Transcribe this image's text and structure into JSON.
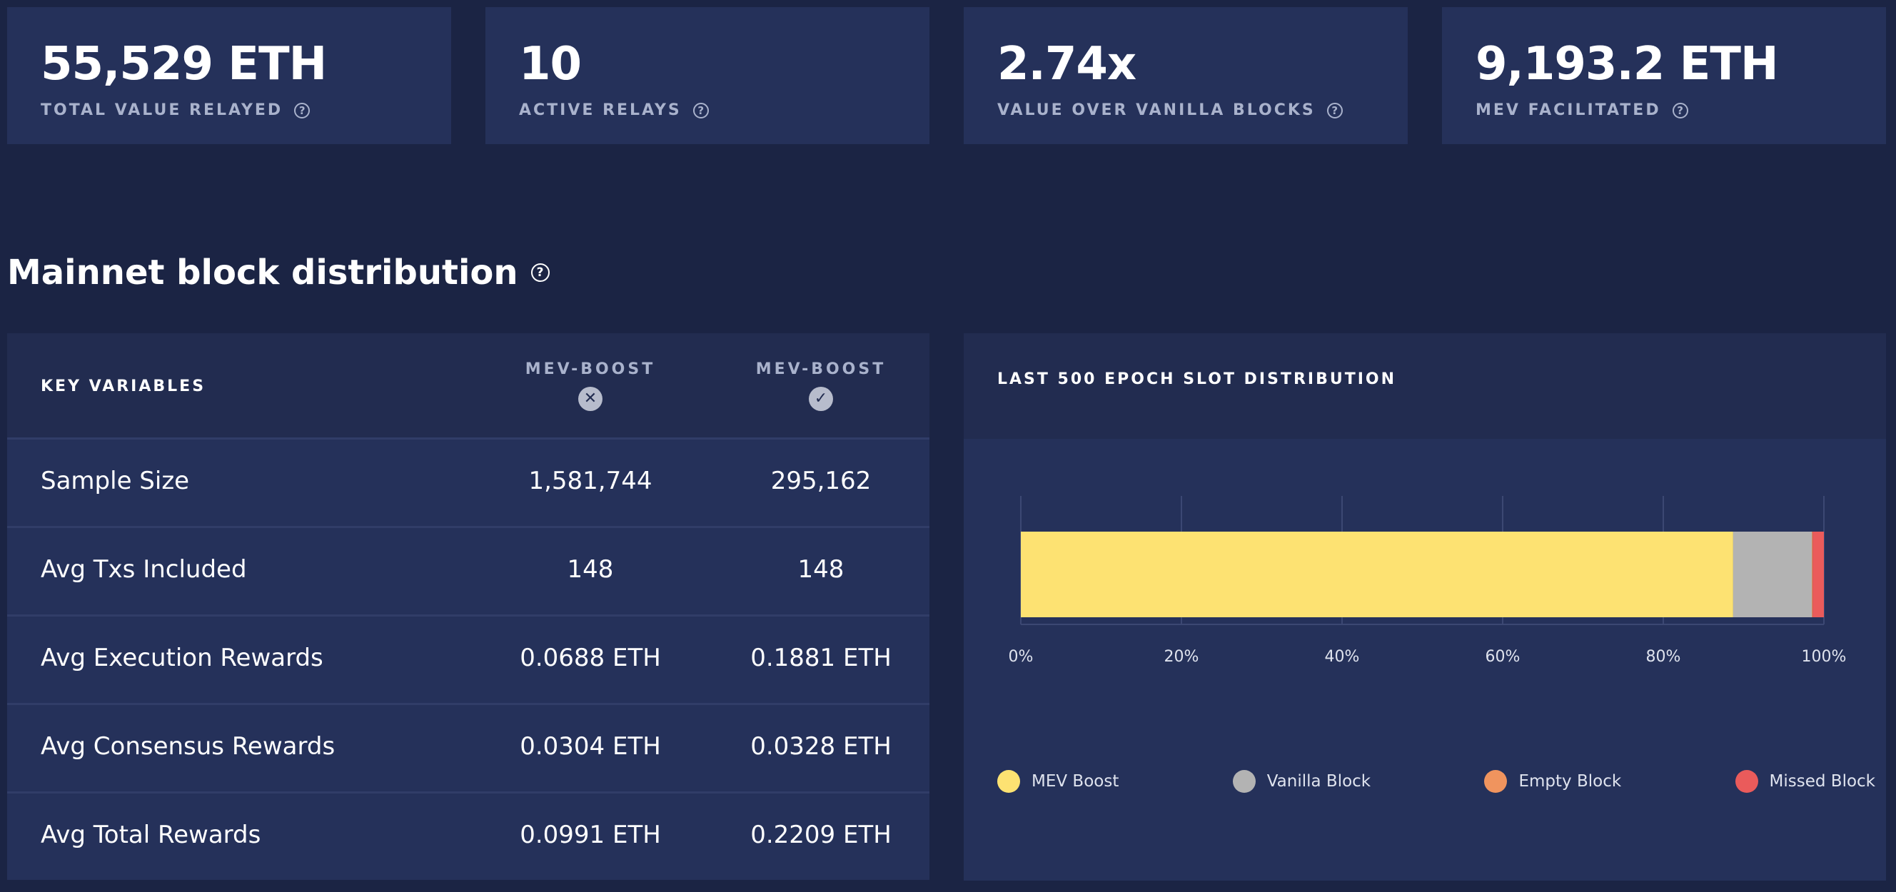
{
  "stats": [
    {
      "value": "55,529 ETH",
      "label": "TOTAL VALUE RELAYED"
    },
    {
      "value": "10",
      "label": "ACTIVE RELAYS"
    },
    {
      "value": "2.74x",
      "label": "VALUE OVER VANILLA BLOCKS"
    },
    {
      "value": "9,193.2 ETH",
      "label": "MEV FACILITATED"
    }
  ],
  "help_glyph": "?",
  "section": {
    "title": "Mainnet block distribution"
  },
  "table": {
    "key_header": "KEY VARIABLES",
    "col1": {
      "label": "MEV-BOOST",
      "icon": "x-circle-icon",
      "glyph": "✕"
    },
    "col2": {
      "label": "MEV-BOOST",
      "icon": "check-circle-icon",
      "glyph": "✓"
    },
    "rows": [
      {
        "name": "Sample Size",
        "without": "1,581,744",
        "with": "295,162"
      },
      {
        "name": "Avg Txs Included",
        "without": "148",
        "with": "148"
      },
      {
        "name": "Avg Execution Rewards",
        "without": "0.0688 ETH",
        "with": "0.1881 ETH"
      },
      {
        "name": "Avg Consensus Rewards",
        "without": "0.0304 ETH",
        "with": "0.0328 ETH"
      },
      {
        "name": "Avg Total Rewards",
        "without": "0.0991 ETH",
        "with": "0.2209 ETH"
      }
    ]
  },
  "chart_data": {
    "type": "bar",
    "orientation": "horizontal",
    "stacked": true,
    "title": "LAST 500 EPOCH SLOT DISTRIBUTION",
    "xlim": [
      0,
      100
    ],
    "x_ticks": [
      "0%",
      "20%",
      "40%",
      "60%",
      "80%",
      "100%"
    ],
    "grid": true,
    "legend_position": "bottom",
    "series": [
      {
        "name": "MEV Boost",
        "value": 88.7,
        "color": "#fde272"
      },
      {
        "name": "Vanilla Block",
        "value": 9.8,
        "color": "#b3b3b3"
      },
      {
        "name": "Empty Block",
        "value": 0.1,
        "color": "#f0945e"
      },
      {
        "name": "Missed Block",
        "value": 1.4,
        "color": "#ea5b5b"
      }
    ]
  },
  "colors": {
    "background": "#1b2444",
    "panel": "#25315a",
    "panel_header": "#222c50",
    "muted_text": "#a9b2cc"
  }
}
